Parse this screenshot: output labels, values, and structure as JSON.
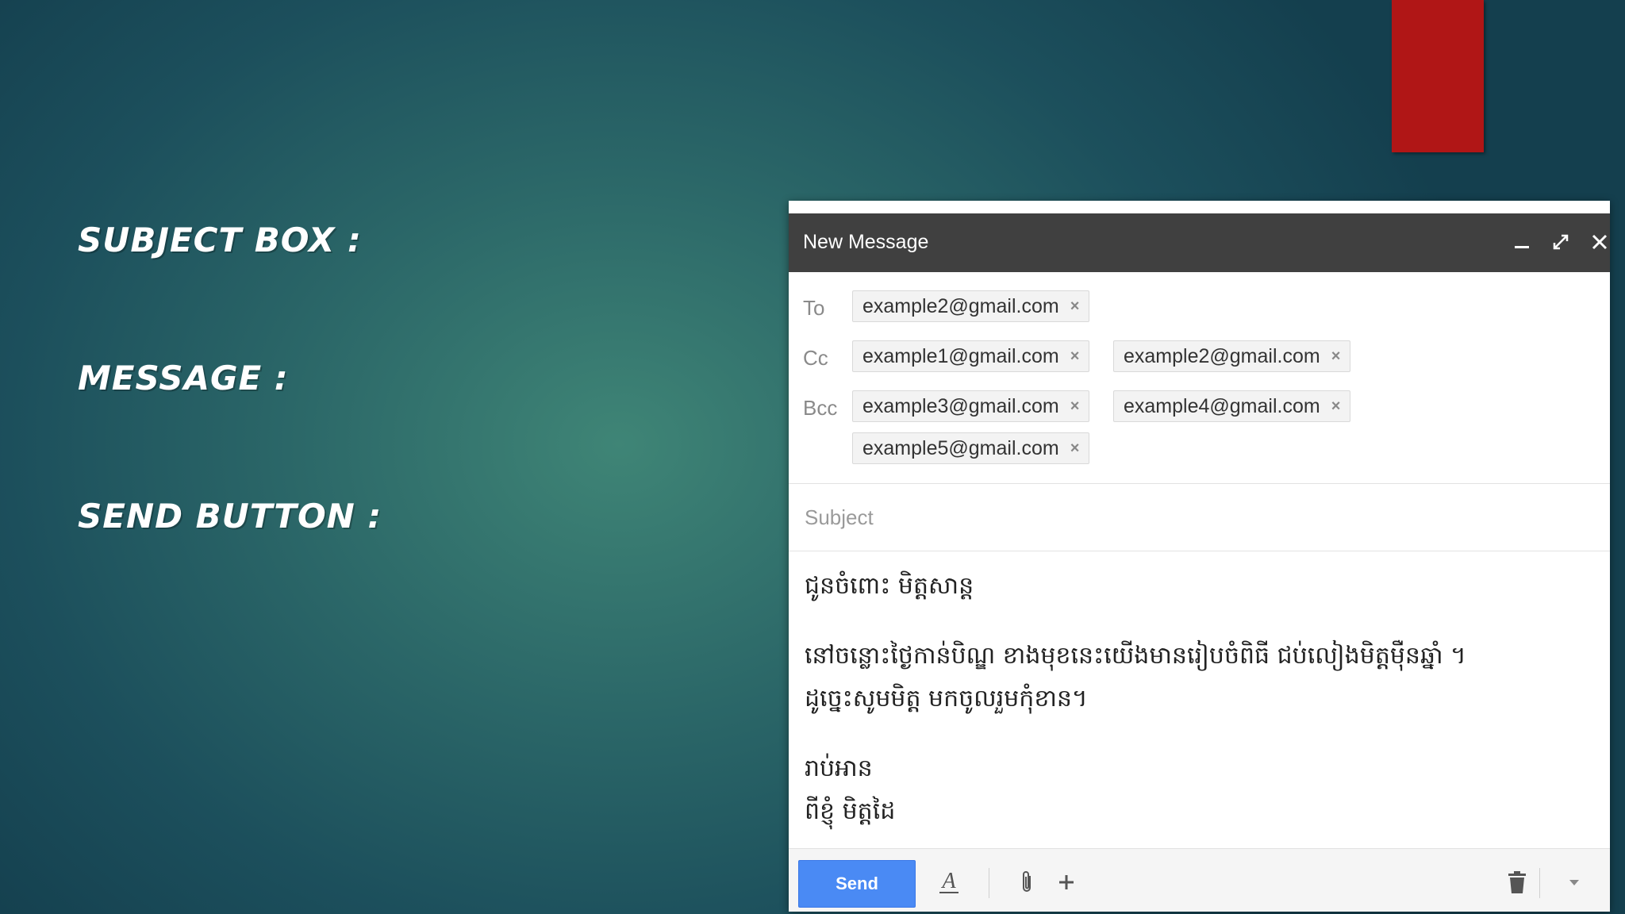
{
  "slide": {
    "labels": [
      "SUBJECT BOX :",
      "MESSAGE :",
      "SEND BUTTON :"
    ]
  },
  "compose": {
    "title": "New Message",
    "header_icons": [
      "minimize-icon",
      "expand-icon",
      "close-icon"
    ],
    "to_label": "To",
    "cc_label": "Cc",
    "bcc_label": "Bcc",
    "to": [
      "example2@gmail.com"
    ],
    "cc": [
      "example1@gmail.com",
      "example2@gmail.com"
    ],
    "bcc": [
      "example3@gmail.com",
      "example4@gmail.com",
      "example5@gmail.com"
    ],
    "chip_remove": "×",
    "subject_placeholder": "Subject",
    "body": [
      "ជូនចំពោះ មិត្តសាន្ត",
      "នៅចន្លោះថ្ងៃកាន់បិណ្ឌ ខាងមុខនេះយើងមានរៀបចំពិធី ជប់លៀងមិត្តម៉ឺនឆ្នាំ ។",
      "ដូច្នេះសូមមិត្ត មកចូលរួមកុំខាន។",
      "រាប់អាន",
      "ពីខ្ញុំ មិត្តដៃ"
    ],
    "send_label": "Send",
    "toolbar_icons": [
      "formatting-icon",
      "attach-icon",
      "more-options-icon",
      "trash-icon",
      "dropdown-icon"
    ]
  },
  "colors": {
    "send_blue": "#4a8af4",
    "header_dark": "#404040",
    "accent_red": "#b01616"
  }
}
